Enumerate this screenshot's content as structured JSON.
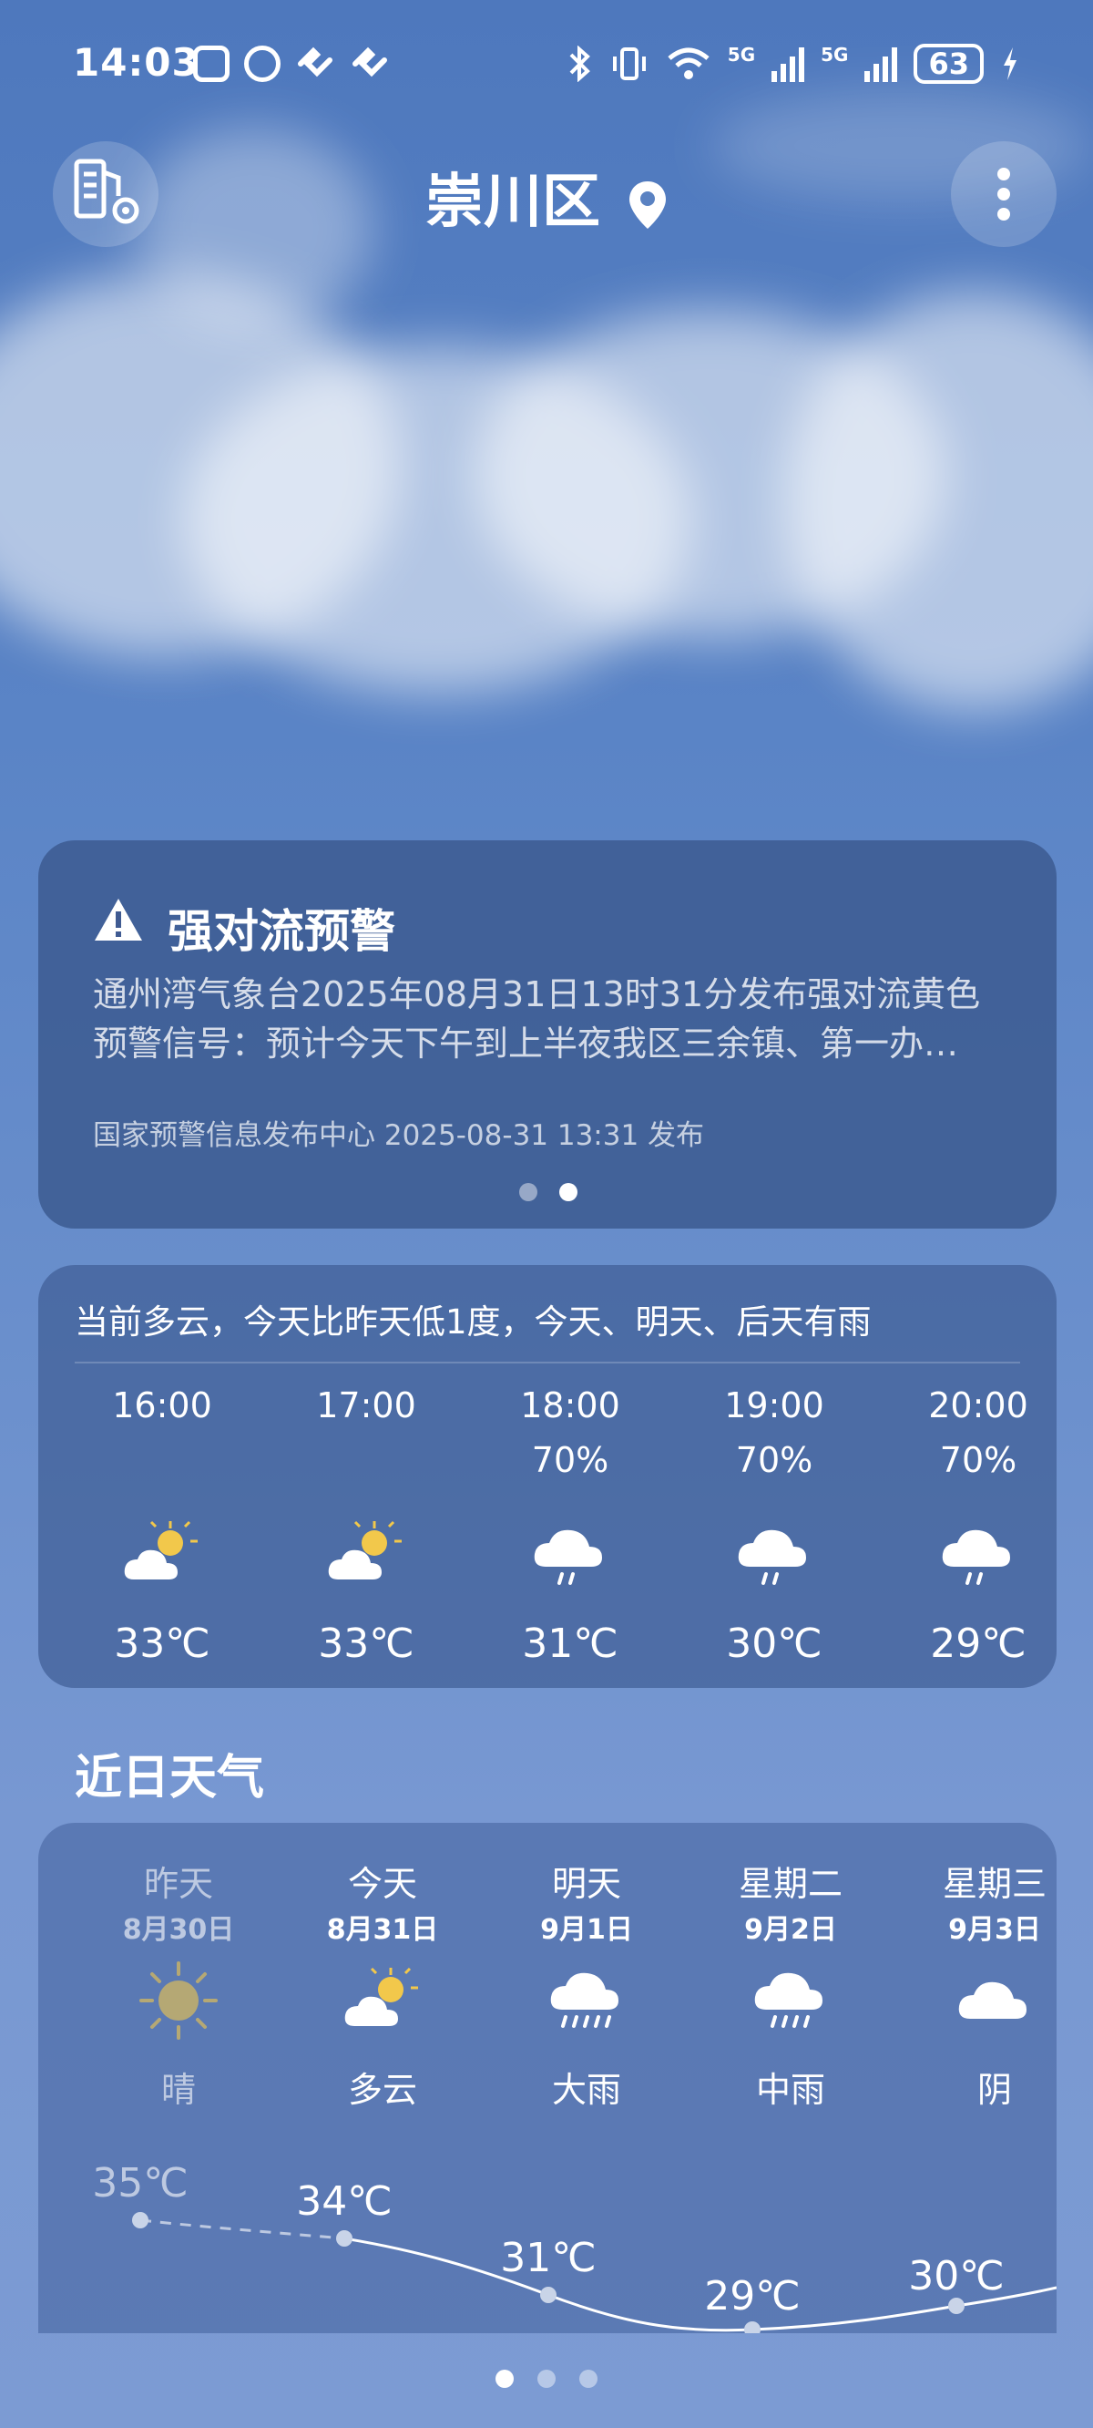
{
  "status": {
    "time": "14:03",
    "battery": "63",
    "net1": "5G",
    "net2": "5G"
  },
  "header": {
    "city": "崇川区"
  },
  "alert": {
    "title": "强对流预警",
    "line1": "通州湾气象台2025年08月31日13时31分发布强对流黄色",
    "line2": "预警信号：预计今天下午到上半夜我区三余镇、第一办…",
    "source": "国家预警信息发布中心 2025-08-31 13:31 发布"
  },
  "hourly": {
    "summary": "当前多云，今天比昨天低1度，今天、明天、后天有雨",
    "items": [
      {
        "time": "16:00",
        "precip": "",
        "icon": "partly-cloudy-icon",
        "temp": "33℃"
      },
      {
        "time": "17:00",
        "precip": "",
        "icon": "partly-cloudy-icon",
        "temp": "33℃"
      },
      {
        "time": "18:00",
        "precip": "70%",
        "icon": "light-rain-icon",
        "temp": "31℃"
      },
      {
        "time": "19:00",
        "precip": "70%",
        "icon": "light-rain-icon",
        "temp": "30℃"
      },
      {
        "time": "20:00",
        "precip": "70%",
        "icon": "light-rain-icon",
        "temp": "29℃"
      }
    ]
  },
  "daily": {
    "title": "近日天气",
    "items": [
      {
        "day": "昨天",
        "date": "8月30日",
        "icon": "sunny-icon",
        "cond": "晴",
        "high": "35℃"
      },
      {
        "day": "今天",
        "date": "8月31日",
        "icon": "partly-cloudy-icon",
        "cond": "多云",
        "high": "34℃"
      },
      {
        "day": "明天",
        "date": "9月1日",
        "icon": "heavy-rain-icon",
        "cond": "大雨",
        "high": "31℃"
      },
      {
        "day": "星期二",
        "date": "9月2日",
        "icon": "moderate-rain-icon",
        "cond": "中雨",
        "high": "29℃"
      },
      {
        "day": "星期三",
        "date": "9月3日",
        "icon": "overcast-icon",
        "cond": "阴",
        "high": "30℃"
      }
    ]
  },
  "colors": {
    "sun": "#f2c84b",
    "cloud": "#ffffff"
  }
}
